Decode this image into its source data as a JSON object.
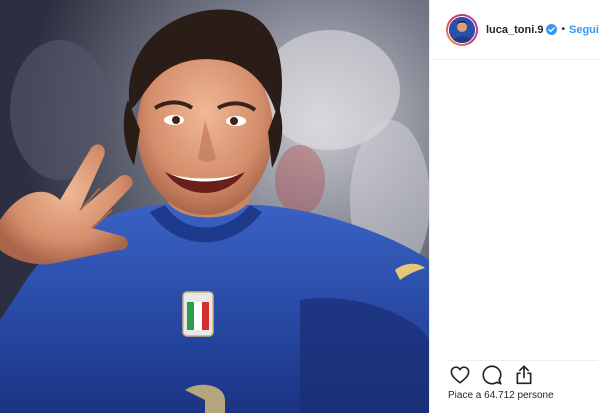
{
  "post": {
    "username": "luca_toni.9",
    "separator": "•",
    "follow_label": "Segui",
    "likes_text": "Piace a 64.712 persone"
  },
  "icons": {
    "verified": "verified-badge-icon",
    "like": "heart-icon",
    "comment": "comment-icon",
    "share": "share-icon"
  },
  "colors": {
    "follow": "#3897f0",
    "verified": "#3897f0",
    "jersey": "#2c4fa8"
  }
}
